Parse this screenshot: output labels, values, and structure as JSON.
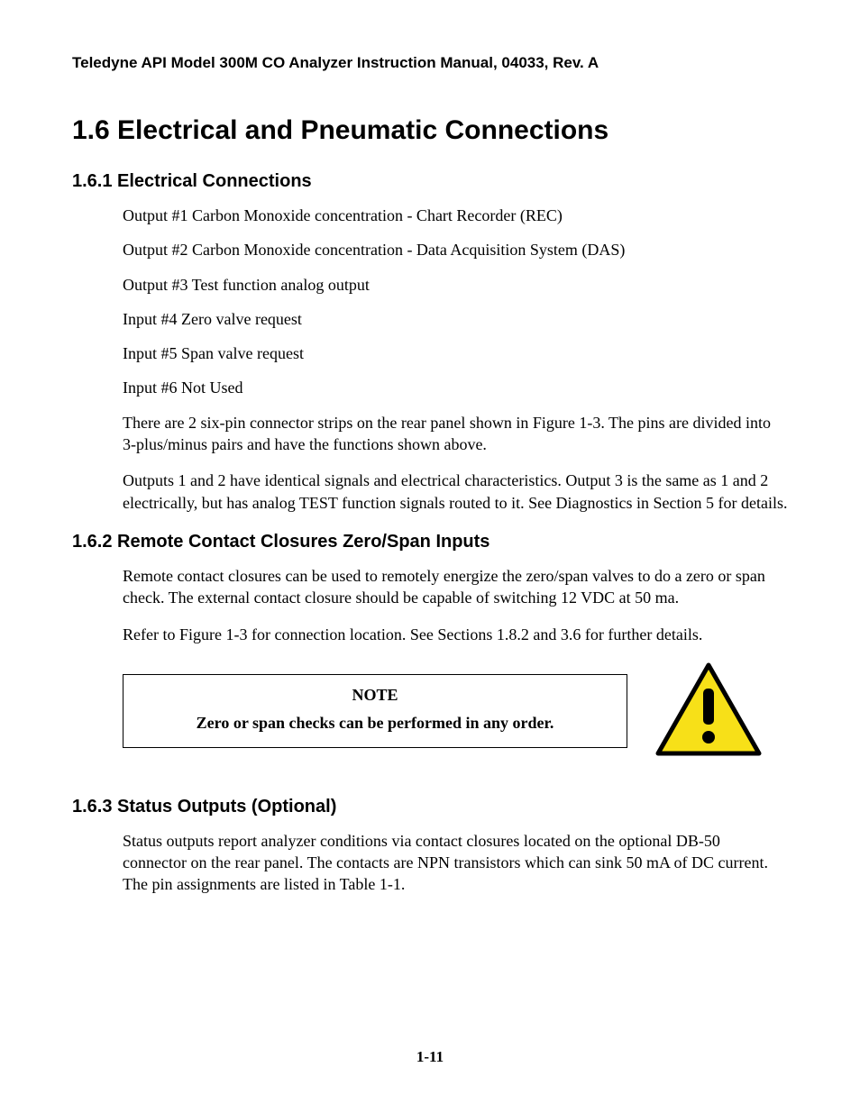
{
  "header": "Teledyne API Model 300M CO Analyzer Instruction Manual, 04033, Rev. A",
  "section": {
    "title": "1.6  Electrical and Pneumatic Connections",
    "s1": {
      "title": "1.6.1  Electrical Connections",
      "lines": [
        "Output #1  Carbon Monoxide concentration - Chart Recorder (REC)",
        "Output #2  Carbon Monoxide concentration - Data Acquisition System (DAS)",
        "Output #3  Test function analog output",
        "Input #4  Zero valve request",
        "Input #5  Span valve request",
        "Input #6  Not Used"
      ],
      "p1": "There are 2 six-pin connector strips on the rear panel shown in Figure 1-3. The pins are divided into 3-plus/minus pairs and have the functions shown above.",
      "p2": "Outputs 1 and 2 have identical signals and electrical characteristics. Output 3 is the same as 1 and 2 electrically, but has analog TEST function signals routed to it. See Diagnostics in Section 5 for details."
    },
    "s2": {
      "title": "1.6.2  Remote Contact Closures Zero/Span Inputs",
      "p1": "Remote contact closures can be used to remotely energize the zero/span valves to do a zero or span check. The external contact closure should be capable of switching 12 VDC at 50 ma.",
      "p2": "Refer to Figure 1-3 for connection location. See Sections 1.8.2 and 3.6 for further details.",
      "note_title": "NOTE",
      "note_body": "Zero or span checks can be performed in any order."
    },
    "s3": {
      "title": "1.6.3  Status Outputs (Optional)",
      "p1": "Status outputs report analyzer conditions via contact closures located on the optional DB-50 connector on the rear panel. The contacts are NPN transistors which can sink 50 mA of DC current. The pin assignments are listed in Table 1-1."
    }
  },
  "page_number": "1-11",
  "icons": {
    "warning": "warning-triangle-icon"
  }
}
